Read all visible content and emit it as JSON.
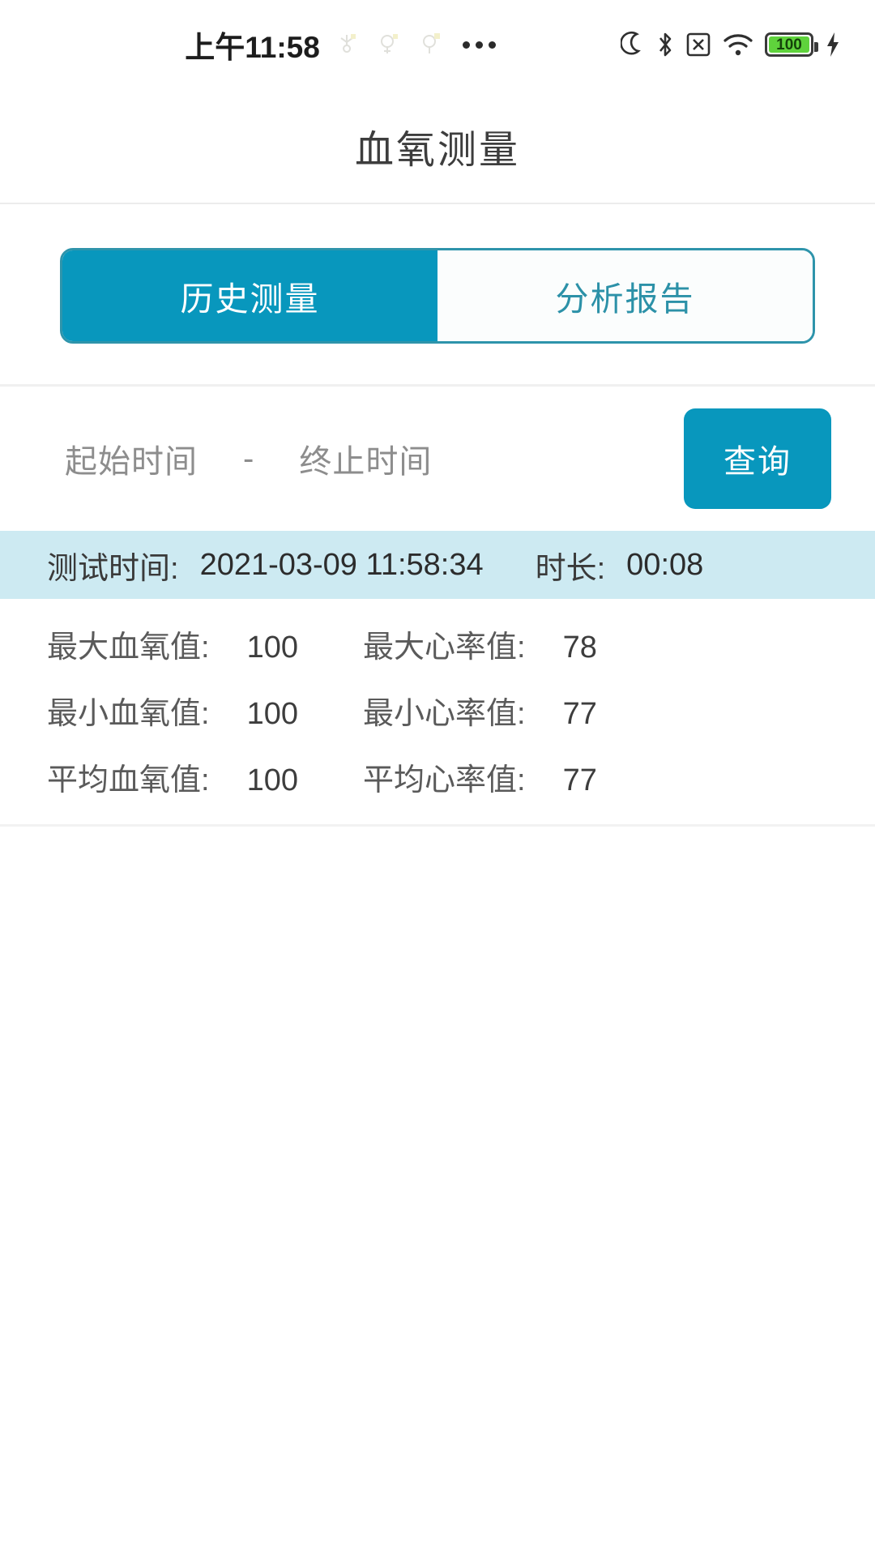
{
  "statusbar": {
    "time": "上午11:58",
    "notification_icons": [
      "app-glyph-icon",
      "app-glyph-icon",
      "app-glyph-icon"
    ],
    "overflow": "more-notifications-dots",
    "right_icons": [
      "dnd-moon-icon",
      "bluetooth-icon",
      "sim-no-card-icon",
      "wifi-icon"
    ],
    "battery_level": "100",
    "charging": "charging-bolt-icon"
  },
  "header": {
    "title": "血氧测量"
  },
  "tabs": [
    {
      "label": "历史测量",
      "active": true
    },
    {
      "label": "分析报告",
      "active": false
    }
  ],
  "filter": {
    "start_placeholder": "起始时间",
    "separator": "-",
    "end_placeholder": "终止时间",
    "query_label": "查询"
  },
  "record": {
    "head": {
      "time_label": "测试时间:",
      "time_value": "2021-03-09 11:58:34",
      "duration_label": "时长:",
      "duration_value": "00:08"
    },
    "rows": [
      {
        "left_label": "最大血氧值:",
        "left_value": "100",
        "right_label": "最大心率值:",
        "right_value": "78"
      },
      {
        "left_label": "最小血氧值:",
        "left_value": "100",
        "right_label": "最小心率值:",
        "right_value": "77"
      },
      {
        "left_label": "平均血氧值:",
        "left_value": "100",
        "right_label": "平均心率值:",
        "right_value": "77"
      }
    ]
  },
  "colors": {
    "accent": "#0897bd",
    "tab_border": "#2e94ab",
    "tab_inactive_text": "#2c91a8",
    "record_head_bg": "#cdeaf2",
    "battery_green": "#5fd33c"
  }
}
